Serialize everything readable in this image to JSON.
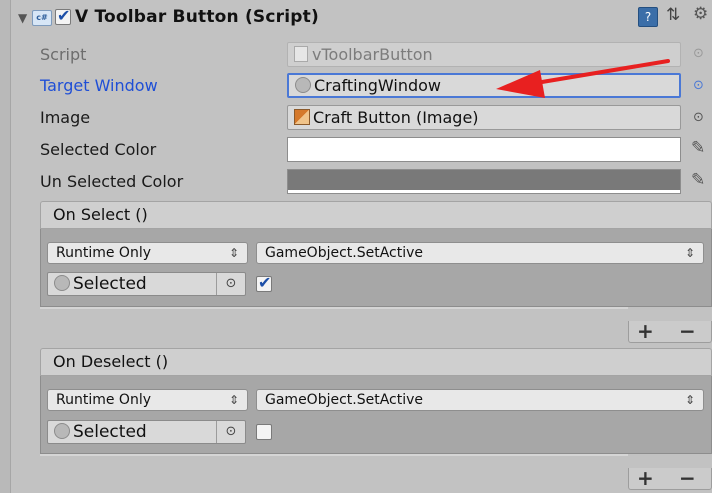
{
  "component": {
    "title": "V Toolbar Button (Script)",
    "enabled": true
  },
  "properties": {
    "script_label": "Script",
    "script_value": "vToolbarButton",
    "target_window_label": "Target Window",
    "target_window_value": "CraftingWindow",
    "image_label": "Image",
    "image_value": "Craft Button (Image)",
    "selected_color_label": "Selected Color",
    "selected_color_value": "#ffffff",
    "unselected_color_label": "Un Selected Color",
    "unselected_color_value": "#797979"
  },
  "events": [
    {
      "header": "On Select ()",
      "runtime": "Runtime Only",
      "function": "GameObject.SetActive",
      "target": "Selected",
      "checked": true
    },
    {
      "header": "On Deselect ()",
      "runtime": "Runtime Only",
      "function": "GameObject.SetActive",
      "target": "Selected",
      "checked": false
    }
  ],
  "footer": {
    "add": "+",
    "remove": "−"
  },
  "colors": {
    "accent": "#1f4fd6",
    "annotation": "#e82020"
  }
}
